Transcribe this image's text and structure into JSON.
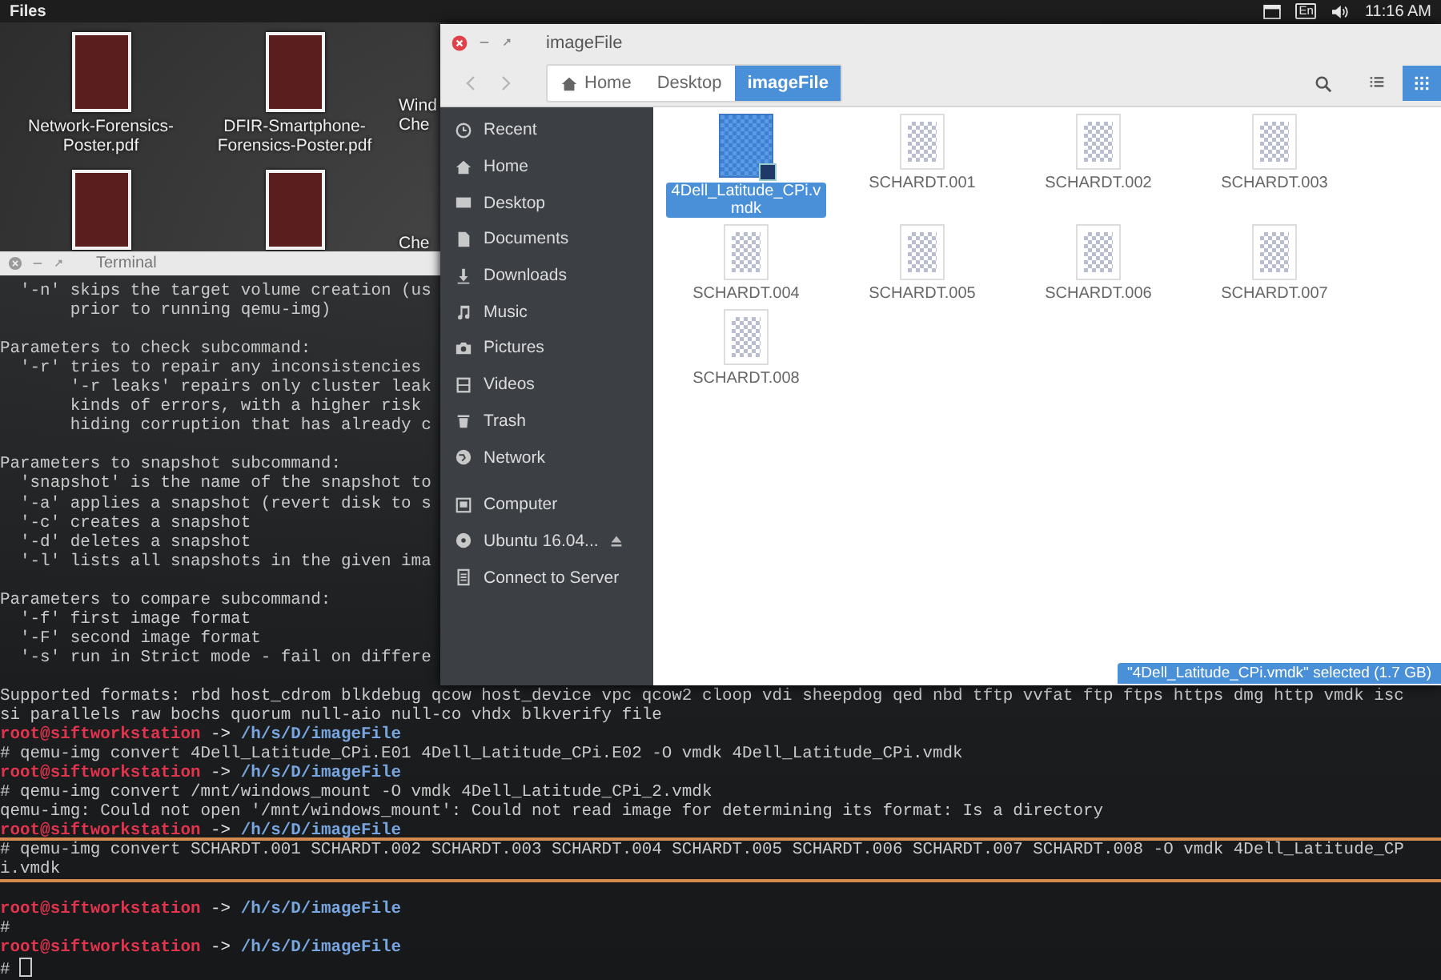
{
  "top_bar": {
    "app_name": "Files",
    "indicators": [
      {
        "kind": "window"
      },
      {
        "kind": "keyboard",
        "label": "En"
      },
      {
        "kind": "volume"
      }
    ],
    "clock": "11:16 AM"
  },
  "desktop_icons": [
    {
      "kind": "pdf",
      "label": "Network-Forensics-Poster.pdf"
    },
    {
      "kind": "pdf",
      "label": "DFIR-Smartphone-Forensics-Poster.pdf"
    },
    {
      "kind": "cut",
      "label": "Wind Che"
    },
    {
      "kind": "pdf"
    },
    {
      "kind": "pdf"
    },
    {
      "kind": "cut",
      "label": "Che"
    }
  ],
  "terminal": {
    "title": "Terminal",
    "lines": [
      {
        "kind": "output",
        "text": "  '-n' skips the target volume creation (us"
      },
      {
        "kind": "output",
        "text": "       prior to running qemu-img)"
      },
      {
        "kind": "blank"
      },
      {
        "kind": "output",
        "text": "Parameters to check subcommand:"
      },
      {
        "kind": "output",
        "text": "  '-r' tries to repair any inconsistencies"
      },
      {
        "kind": "output",
        "text": "       '-r leaks' repairs only cluster leak"
      },
      {
        "kind": "output",
        "text": "       kinds of errors, with a higher risk"
      },
      {
        "kind": "output",
        "text": "       hiding corruption that has already c"
      },
      {
        "kind": "blank"
      },
      {
        "kind": "output",
        "text": "Parameters to snapshot subcommand:"
      },
      {
        "kind": "output",
        "text": "  'snapshot' is the name of the snapshot to"
      },
      {
        "kind": "output",
        "text": "  '-a' applies a snapshot (revert disk to s"
      },
      {
        "kind": "output",
        "text": "  '-c' creates a snapshot"
      },
      {
        "kind": "output",
        "text": "  '-d' deletes a snapshot"
      },
      {
        "kind": "output",
        "text": "  '-l' lists all snapshots in the given ima"
      },
      {
        "kind": "blank"
      },
      {
        "kind": "output",
        "text": "Parameters to compare subcommand:"
      },
      {
        "kind": "output",
        "text": "  '-f' first image format"
      },
      {
        "kind": "output",
        "text": "  '-F' second image format"
      },
      {
        "kind": "output",
        "text": "  '-s' run in Strict mode - fail on differe"
      },
      {
        "kind": "blank"
      },
      {
        "kind": "output",
        "text": "Supported formats: rbd host_cdrom blkdebug qcow host_device vpc qcow2 cloop vdi sheepdog qed nbd tftp vvfat ftp ftps https dmg http vmdk isc"
      },
      {
        "kind": "output",
        "text": "si parallels raw bochs quorum null-aio null-co vhdx blkverify file"
      },
      {
        "kind": "prompt",
        "user": "root@siftworkstation",
        "arrow": "->",
        "path": "/h/s/D/imageFile"
      },
      {
        "kind": "output",
        "text": "# qemu-img convert 4Dell_Latitude_CPi.E01 4Dell_Latitude_CPi.E02 -O vmdk 4Dell_Latitude_CPi.vmdk"
      },
      {
        "kind": "prompt",
        "user": "root@siftworkstation",
        "arrow": "->",
        "path": "/h/s/D/imageFile"
      },
      {
        "kind": "output",
        "text": "# qemu-img convert /mnt/windows_mount -O vmdk 4Dell_Latitude_CPi_2.vmdk"
      },
      {
        "kind": "output",
        "text": "qemu-img: Could not open '/mnt/windows_mount': Could not read image for determining its format: Is a directory"
      },
      {
        "kind": "prompt",
        "user": "root@siftworkstation",
        "arrow": "->",
        "path": "/h/s/D/imageFile"
      },
      {
        "kind": "highlighted",
        "lines": [
          "# qemu-img convert SCHARDT.001 SCHARDT.002 SCHARDT.003 SCHARDT.004 SCHARDT.005 SCHARDT.006 SCHARDT.007 SCHARDT.008 -O vmdk 4Dell_Latitude_CP",
          "i.vmdk"
        ]
      },
      {
        "kind": "blank"
      },
      {
        "kind": "prompt",
        "user": "root@siftworkstation",
        "arrow": "->",
        "path": "/h/s/D/imageFile"
      },
      {
        "kind": "output",
        "text": "#"
      },
      {
        "kind": "prompt",
        "user": "root@siftworkstation",
        "arrow": "->",
        "path": "/h/s/D/imageFile"
      },
      {
        "kind": "cursor",
        "text": "#"
      }
    ]
  },
  "files_window": {
    "title": "imageFile",
    "nav": [
      {
        "kind": "back",
        "disabled": true
      },
      {
        "kind": "forward",
        "disabled": true
      }
    ],
    "breadcrumbs": [
      {
        "kind": "home",
        "label": "Home",
        "selected": false
      },
      {
        "kind": "folder",
        "label": "Desktop",
        "selected": false
      },
      {
        "kind": "folder",
        "label": "imageFile",
        "selected": true
      }
    ],
    "view_buttons": [
      {
        "kind": "list",
        "selected": false
      },
      {
        "kind": "grid",
        "selected": true
      }
    ],
    "sidebar": {
      "places": [
        {
          "kind": "recent",
          "label": "Recent"
        },
        {
          "kind": "home",
          "label": "Home"
        },
        {
          "kind": "desktop",
          "label": "Desktop"
        },
        {
          "kind": "documents",
          "label": "Documents"
        },
        {
          "kind": "downloads",
          "label": "Downloads"
        },
        {
          "kind": "music",
          "label": "Music"
        },
        {
          "kind": "pictures",
          "label": "Pictures"
        },
        {
          "kind": "videos",
          "label": "Videos"
        },
        {
          "kind": "trash",
          "label": "Trash"
        },
        {
          "kind": "network",
          "label": "Network"
        }
      ],
      "devices": [
        {
          "kind": "computer",
          "label": "Computer",
          "ejectable": false
        },
        {
          "kind": "disc",
          "label": "Ubuntu 16.04...",
          "ejectable": true
        },
        {
          "kind": "server",
          "label": "Connect to Server",
          "ejectable": false
        }
      ]
    },
    "files": [
      {
        "name": "4Dell_Latitude_CPi.vmdk",
        "selected": true
      },
      {
        "name": "SCHARDT.001",
        "selected": false
      },
      {
        "name": "SCHARDT.002",
        "selected": false
      },
      {
        "name": "SCHARDT.003",
        "selected": false
      },
      {
        "name": "SCHARDT.004",
        "selected": false
      },
      {
        "name": "SCHARDT.005",
        "selected": false
      },
      {
        "name": "SCHARDT.006",
        "selected": false
      },
      {
        "name": "SCHARDT.007",
        "selected": false
      },
      {
        "name": "SCHARDT.008",
        "selected": false
      }
    ],
    "status": "\"4Dell_Latitude_CPi.vmdk\" selected (1.7 GB)"
  }
}
